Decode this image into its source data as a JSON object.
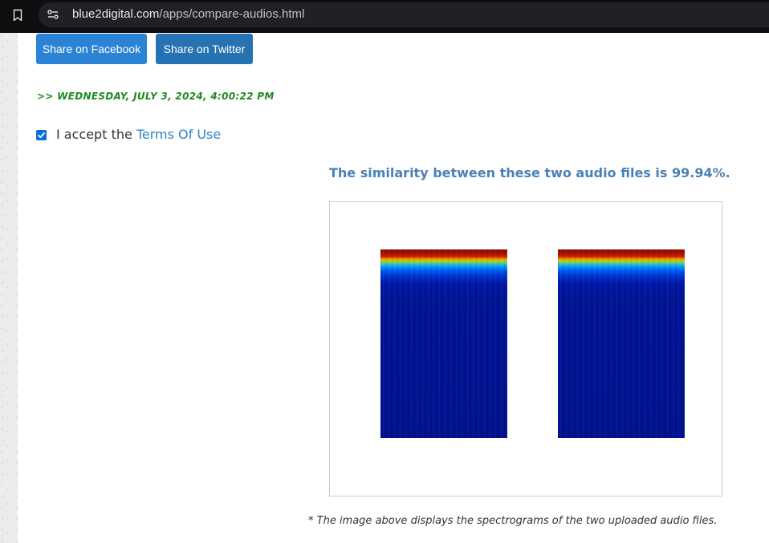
{
  "browser": {
    "url_host": "blue2digital.com",
    "url_path": "/apps/compare-audios.html",
    "icons": {
      "bookmark": "bookmark-icon",
      "site_info": "tune-icon"
    }
  },
  "share": {
    "facebook_label": "Share on Facebook",
    "twitter_label": "Share on Twitter"
  },
  "datetime": ">> WEDNESDAY, JULY 3, 2024, 4:00:22 PM",
  "terms": {
    "checked": true,
    "prefix": "I accept the",
    "link": "Terms Of Use"
  },
  "result": {
    "similarity_text": "The similarity between these two audio files is 99.94%."
  },
  "caption": "* The image above displays the spectrograms of the two uploaded audio files.",
  "colors": {
    "facebook": "#2b83d6",
    "twitter": "#2672b3",
    "datetime": "#1e8a1e",
    "link": "#2a86c4",
    "similarity": "#4a82b5",
    "checkbox": "#0b6fd9"
  }
}
